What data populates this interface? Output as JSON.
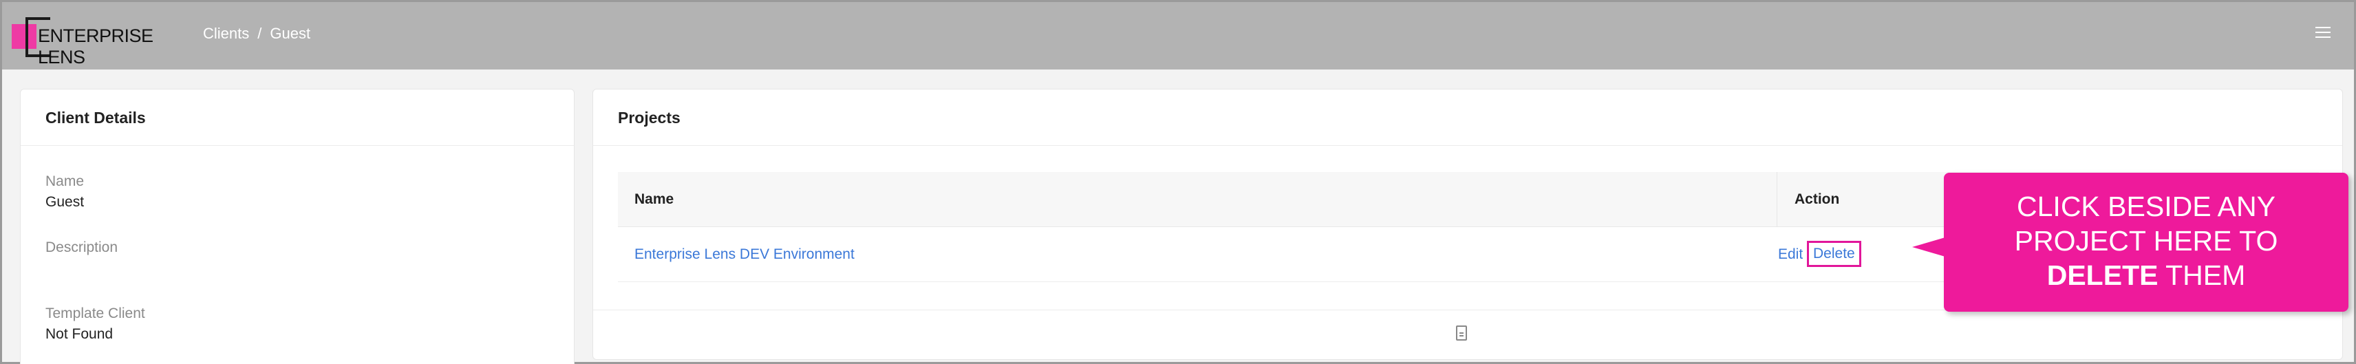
{
  "header": {
    "logo_text": "ENTERPRISE LENS",
    "breadcrumb": [
      "Clients",
      "Guest"
    ],
    "breadcrumb_separator": "/"
  },
  "client_details": {
    "title": "Client Details",
    "fields": [
      {
        "label": "Name",
        "value": "Guest"
      },
      {
        "label": "Description",
        "value": ""
      },
      {
        "label": "Template Client",
        "value": "Not Found"
      }
    ]
  },
  "projects": {
    "title": "Projects",
    "columns": [
      "Name",
      "Action"
    ],
    "rows": [
      {
        "name": "Enterprise Lens DEV Environment",
        "edit": "Edit",
        "delete": "Delete"
      }
    ]
  },
  "callout": {
    "line1": "CLICK BESIDE ANY",
    "line2": "PROJECT HERE TO",
    "bold": "DELETE",
    "tail": "THEM"
  },
  "colors": {
    "brand": "#ee3aa4",
    "link": "#3b78d8",
    "callout": "#ee1a9b",
    "topbar": "#b3b3b3"
  }
}
